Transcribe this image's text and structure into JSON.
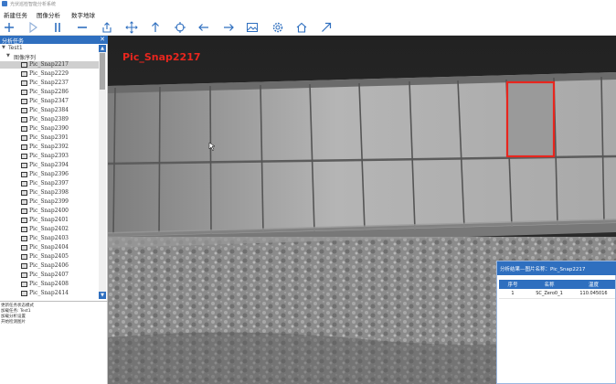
{
  "window": {
    "title": "光伏巡检智能分析系统"
  },
  "menu": {
    "items": [
      "新建任务",
      "图像分析",
      "数字地球"
    ]
  },
  "toolbar": {
    "icons": [
      "plus-icon",
      "play-icon",
      "pause-icon",
      "minus-icon",
      "export-icon",
      "move-icon",
      "arrow-up-icon",
      "target-icon",
      "arrow-left-icon",
      "arrow-right-icon",
      "image-icon",
      "settings-icon",
      "home-icon",
      "arrow-diagonal-icon"
    ],
    "accent": "#2f6fbf"
  },
  "sidebar": {
    "header": "分析任务",
    "close": "✕",
    "root": "Test1",
    "group": "图像序列",
    "items": [
      "Pic_Snap2217",
      "Pic_Snap2229",
      "Pic_Snap2237",
      "Pic_Snap2286",
      "Pic_Snap2347",
      "Pic_Snap2384",
      "Pic_Snap2389",
      "Pic_Snap2390",
      "Pic_Snap2391",
      "Pic_Snap2392",
      "Pic_Snap2393",
      "Pic_Snap2394",
      "Pic_Snap2396",
      "Pic_Snap2397",
      "Pic_Snap2398",
      "Pic_Snap2399",
      "Pic_Snap2400",
      "Pic_Snap2401",
      "Pic_Snap2402",
      "Pic_Snap2403",
      "Pic_Snap2404",
      "Pic_Snap2405",
      "Pic_Snap2406",
      "Pic_Snap2407",
      "Pic_Snap2408",
      "Pic_Snap2414"
    ],
    "selected_index": 0,
    "log": [
      "更新任务状态模式",
      "加载任务: Test1",
      "加载分析设置",
      "开始检测图片"
    ]
  },
  "viewer": {
    "snapshot_label": "Pic_Snap2217",
    "highlight_color": "#e8261e"
  },
  "result_panel": {
    "title": "分析结果—图片名称：Pic_Snap2217",
    "columns": [
      "序号",
      "名称",
      "温度"
    ],
    "rows": [
      [
        "1",
        "SC_Zero0_1",
        "110.045016"
      ]
    ]
  }
}
